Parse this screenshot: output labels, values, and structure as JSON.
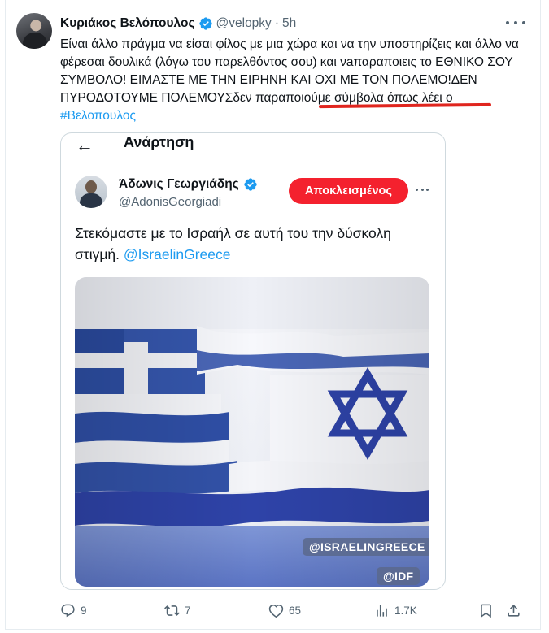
{
  "tweet": {
    "author_name": "Κυριάκος Βελόπουλος",
    "handle": "@velopky",
    "separator": "·",
    "time": "5h",
    "text_part1": "Είναι άλλο πράγμα να είσαι φίλος με μια χώρα και να την υποστηρίζεις και άλλο να φέρεσαι δουλικά (λόγω του παρελθόντος σου) και νaπαραποιεις το ΕΘΝΙΚΟ ΣΟΥ ΣΥΜΒΟΛΟ! ΕΙΜΑΣΤΕ ΜΕ ΤΗΝ ΕΙΡΗΝΗ ΚΑΙ ΟΧΙ ΜΕ ΤΟΝ ΠΟΛΕΜΟ!ΔΕΝ ΠΥΡΟΔΟΤΟΥΜΕ ΠΟΛΕΜΟΥΣδεν παραποιούμε σύμβολα όπως λέει ο ",
    "hashtag": "#Βελοπουλος",
    "counts": {
      "replies": "9",
      "reposts": "7",
      "likes": "65",
      "views": "1.7K"
    }
  },
  "quoted": {
    "topbar_title": "Ανάρτηση",
    "author_name": "Άδωνις Γεωργιάδης",
    "handle": "@AdonisGeorgiadi",
    "blocked_label": "Αποκλεισμένος",
    "text": "Στεκόμαστε με το Ισραήλ σε αυτή του την δύσκολη στιγμή. ",
    "mention": "@IsraelinGreece",
    "image": {
      "tag1": "@ISRAELINGREECE",
      "tag2": "@IDF"
    }
  },
  "colors": {
    "accent": "#1d9bf0",
    "blocked": "#f4212e",
    "annotation_underline": "#e0251e",
    "flag_blue": "#2a4a9e",
    "israel_blue": "#2e43a8"
  },
  "icons": [
    "verified-badge-icon",
    "more-icon",
    "back-arrow-icon",
    "reply-icon",
    "repost-icon",
    "like-icon",
    "views-icon",
    "bookmark-icon",
    "share-icon"
  ]
}
